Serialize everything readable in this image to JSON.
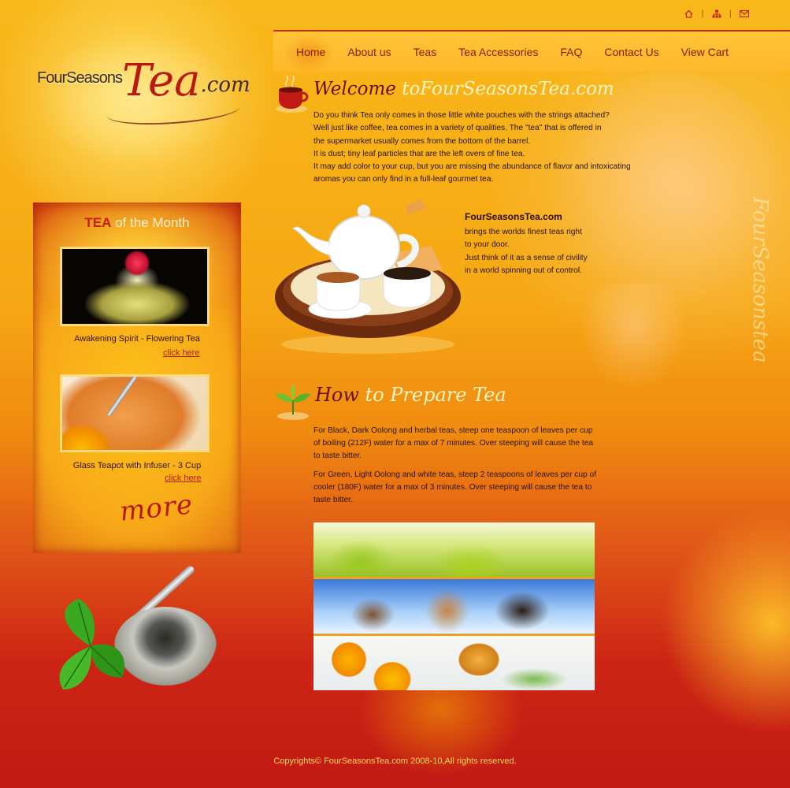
{
  "utility_icons": [
    "home-icon",
    "sitemap-icon",
    "mail-icon"
  ],
  "nav": {
    "items": [
      "Home",
      "About us",
      "Teas",
      "Tea Accessories",
      "FAQ",
      "Contact Us",
      "View Cart"
    ]
  },
  "logo": {
    "part1": "FourSeasons",
    "part2": "Tea",
    "part3": ".com"
  },
  "tea_of_month": {
    "title_highlight": "TEA",
    "title_rest": " of the Month",
    "products": [
      {
        "name": "Awakening Spirit - Flowering Tea",
        "link": "click here"
      },
      {
        "name": "Glass Teapot with Infuser - 3 Cup",
        "link": "click here"
      }
    ],
    "more": "more"
  },
  "welcome": {
    "heading_dark": "Welcome",
    "heading_light": " toFourSeasonsTea.com",
    "lines": [
      "Do you think Tea only comes in those little white pouches with the strings attached?",
      "Well just like coffee, tea comes in a variety of qualities.  The \"tea\" that is offered in",
      "the supermarket usually comes from the bottom of the barrel.",
      "It is dust; tiny leaf particles that are the left overs of fine tea.",
      "It may add color to your cup, but you are missing the abundance of flavor and intoxicating",
      "aromas you can only find in a full-leaf gourmet tea."
    ]
  },
  "promo": {
    "title": "FourSeasonsTea.com",
    "lines": [
      "brings the worlds finest teas right",
      "to your door.",
      "Just think of it as a sense of civility",
      "in a world spinning out of control."
    ]
  },
  "side_script": "FourSeasonstea",
  "prepare": {
    "heading_dark": "How",
    "heading_light": " to Prepare Tea",
    "para1": "For Black, Dark Oolong and herbal teas, steep one teaspoon of leaves per cup of boiling (212F) water for a max of 7 minutes. Over steeping will cause the tea to taste bitter.",
    "para2": "For Green, Light Oolong and white teas, steep 2 teaspoons of leaves per cup of cooler (180F) water for a max of 3 minutes. Over steeping will cause the tea to taste bitter."
  },
  "footer": "Copyrights© FourSeasonsTea.com 2008-10,All rights reserved.",
  "colors": {
    "accent_red": "#b81a12",
    "nav_bg": "#ffb82a",
    "page_top": "#f8b81a",
    "page_bottom": "#c21a14"
  }
}
